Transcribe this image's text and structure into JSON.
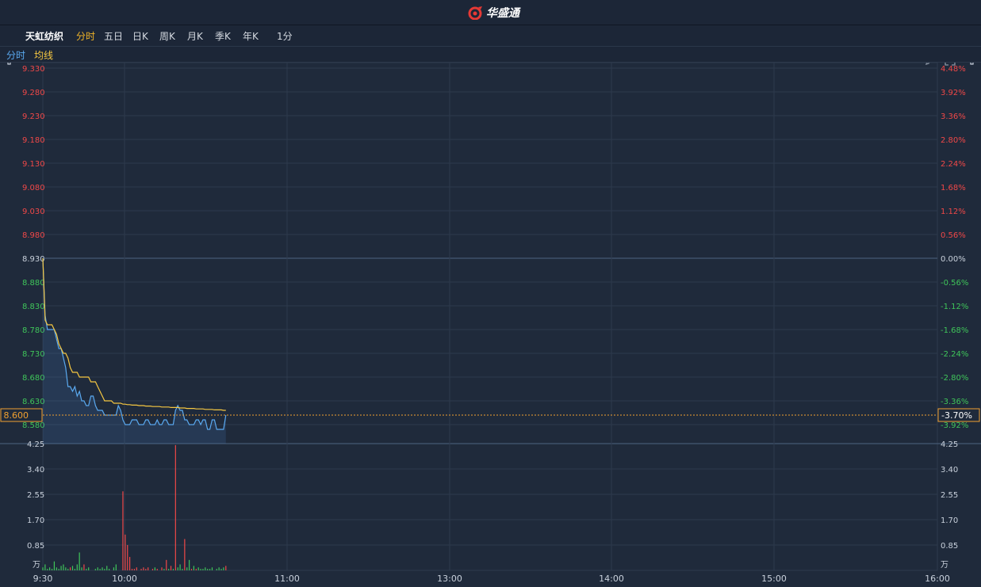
{
  "header": {
    "brand": "华盛通"
  },
  "toolbar": {
    "stock_name": "天虹纺织",
    "tabs": [
      "分时",
      "五日",
      "日K",
      "周K",
      "月K",
      "季K",
      "年K"
    ],
    "active_tab": "分时",
    "interval": "1分"
  },
  "legend": {
    "time_label": "分时",
    "avg_label": "均线"
  },
  "colors": {
    "price_line": "#5aa9f0",
    "avg_line": "#f5c742",
    "up": "#f04848",
    "down": "#3fc55a",
    "grid": "#2e3a4c",
    "marker": "#f0a030"
  },
  "chart_data": {
    "type": "line",
    "prev_close": 8.93,
    "current_price": "8.600",
    "current_change": "-3.70%",
    "price_ticks_up": [
      "9.330",
      "9.280",
      "9.230",
      "9.180",
      "9.130",
      "9.080",
      "9.030",
      "8.980"
    ],
    "price_tick_mid": "8.930",
    "price_ticks_down": [
      "8.880",
      "8.830",
      "8.780",
      "8.730",
      "8.680",
      "8.630",
      "8.580"
    ],
    "pct_ticks_up": [
      "4.48%",
      "3.92%",
      "3.36%",
      "2.80%",
      "2.24%",
      "1.68%",
      "1.12%",
      "0.56%"
    ],
    "pct_tick_mid": "0.00%",
    "pct_ticks_down": [
      "-0.56%",
      "-1.12%",
      "-1.68%",
      "-2.24%",
      "-2.80%",
      "-3.36%",
      "-3.92%"
    ],
    "volume_ticks": [
      "4.25",
      "3.40",
      "2.55",
      "1.70",
      "0.85"
    ],
    "volume_unit": "万",
    "x_ticks": [
      "9:30",
      "10:00",
      "11:00",
      "13:00",
      "14:00",
      "15:00",
      "16:00"
    ],
    "price_series": [
      8.93,
      8.81,
      8.78,
      8.78,
      8.78,
      8.78,
      8.76,
      8.74,
      8.74,
      8.72,
      8.7,
      8.66,
      8.66,
      8.65,
      8.66,
      8.64,
      8.65,
      8.63,
      8.63,
      8.62,
      8.62,
      8.64,
      8.64,
      8.62,
      8.61,
      8.61,
      8.61,
      8.6,
      8.6,
      8.6,
      8.6,
      8.6,
      8.6,
      8.62,
      8.61,
      8.59,
      8.58,
      8.58,
      8.58,
      8.59,
      8.59,
      8.59,
      8.58,
      8.58,
      8.58,
      8.59,
      8.59,
      8.58,
      8.58,
      8.58,
      8.59,
      8.58,
      8.58,
      8.59,
      8.59,
      8.58,
      8.58,
      8.58,
      8.61,
      8.62,
      8.61,
      8.61,
      8.59,
      8.59,
      8.58,
      8.58,
      8.58,
      8.59,
      8.59,
      8.58,
      8.59,
      8.59,
      8.57,
      8.57,
      8.59,
      8.59,
      8.57,
      8.57,
      8.57,
      8.57,
      8.6
    ],
    "avg_series": [
      8.93,
      8.8,
      8.79,
      8.79,
      8.79,
      8.78,
      8.77,
      8.75,
      8.74,
      8.73,
      8.73,
      8.72,
      8.7,
      8.69,
      8.69,
      8.69,
      8.68,
      8.68,
      8.68,
      8.68,
      8.68,
      8.67,
      8.67,
      8.67,
      8.66,
      8.65,
      8.64,
      8.63,
      8.63,
      8.63,
      8.63,
      8.625,
      8.625,
      8.625,
      8.625,
      8.623,
      8.623,
      8.622,
      8.622,
      8.621,
      8.621,
      8.621,
      8.62,
      8.62,
      8.62,
      8.619,
      8.619,
      8.619,
      8.618,
      8.618,
      8.618,
      8.618,
      8.617,
      8.617,
      8.617,
      8.617,
      8.616,
      8.616,
      8.616,
      8.616,
      8.615,
      8.615,
      8.615,
      8.614,
      8.614,
      8.614,
      8.614,
      8.613,
      8.613,
      8.613,
      8.613,
      8.612,
      8.612,
      8.612,
      8.612,
      8.611,
      8.611,
      8.611,
      8.611,
      8.61,
      8.61
    ],
    "volume_series": [
      0.1,
      0.2,
      0.05,
      0.1,
      0.05,
      0.3,
      0.1,
      0.05,
      0.15,
      0.2,
      0.1,
      0.05,
      0.1,
      0.15,
      0.05,
      0.2,
      0.6,
      0.1,
      0.2,
      0.05,
      0.1,
      0.0,
      0.0,
      0.05,
      0.1,
      0.05,
      0.1,
      0.05,
      0.15,
      0.05,
      0.0,
      0.1,
      0.2,
      0.0,
      0.0,
      2.65,
      1.2,
      0.85,
      0.45,
      0.05,
      0.05,
      0.1,
      0.0,
      0.05,
      0.1,
      0.05,
      0.1,
      0.0,
      0.05,
      0.1,
      0.05,
      0.0,
      0.1,
      0.05,
      0.35,
      0.05,
      0.15,
      0.05,
      4.2,
      0.1,
      0.2,
      0.05,
      1.05,
      0.1,
      0.35,
      0.05,
      0.15,
      0.05,
      0.1,
      0.05,
      0.05,
      0.1,
      0.05,
      0.05,
      0.1,
      0.0,
      0.05,
      0.1,
      0.05,
      0.1,
      0.15
    ],
    "volume_up": [
      false,
      false,
      false,
      false,
      false,
      false,
      false,
      false,
      false,
      false,
      false,
      false,
      true,
      false,
      false,
      false,
      false,
      false,
      true,
      false,
      false,
      false,
      false,
      false,
      false,
      false,
      false,
      false,
      false,
      false,
      false,
      false,
      false,
      false,
      false,
      true,
      true,
      true,
      true,
      true,
      true,
      true,
      false,
      true,
      true,
      true,
      true,
      false,
      true,
      false,
      true,
      false,
      true,
      false,
      true,
      false,
      true,
      false,
      true,
      false,
      false,
      false,
      true,
      false,
      false,
      true,
      false,
      true,
      false,
      false,
      false,
      false,
      false,
      false,
      false,
      false,
      false,
      false,
      false,
      false,
      true
    ],
    "ylim": [
      8.53,
      9.33
    ],
    "vol_max": 4.25
  }
}
